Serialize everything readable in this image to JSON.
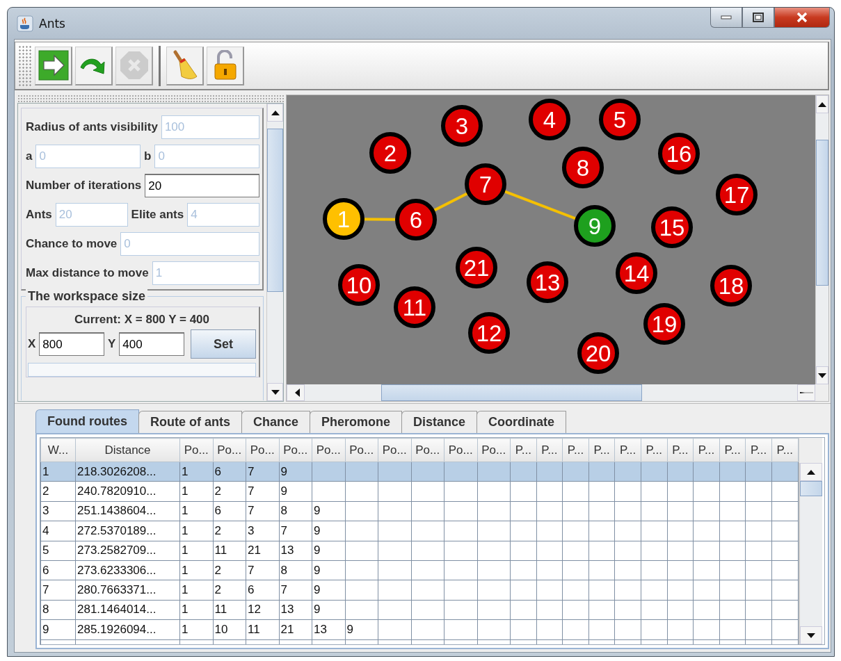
{
  "window": {
    "title": "Ants"
  },
  "toolbar": [
    {
      "kind": "run",
      "disabled": false
    },
    {
      "kind": "step",
      "disabled": false
    },
    {
      "kind": "stop",
      "disabled": true
    },
    {
      "kind": "clear",
      "disabled": false
    },
    {
      "kind": "unlock",
      "disabled": false
    }
  ],
  "parameters": [
    {
      "fields": [
        {
          "label": "Radius of ants visibility",
          "value": "100",
          "disabled": true
        }
      ]
    },
    {
      "fields": [
        {
          "label": "a",
          "value": "0",
          "disabled": true
        },
        {
          "label": "b",
          "value": "0",
          "disabled": true
        }
      ]
    },
    {
      "fields": [
        {
          "label": "Number of iterations",
          "value": "20",
          "disabled": false
        }
      ]
    },
    {
      "fields": [
        {
          "label": "Ants",
          "value": "20",
          "disabled": true
        },
        {
          "label": "Elite ants",
          "value": "4",
          "disabled": true
        }
      ]
    },
    {
      "fields": [
        {
          "label": "Chance to move",
          "value": "0",
          "disabled": true
        }
      ]
    },
    {
      "fields": [
        {
          "label": "Max distance to move",
          "value": "1",
          "disabled": true
        }
      ]
    }
  ],
  "workspace": {
    "title": "The workspace size",
    "current": "Current: X = 800 Y = 400",
    "fields": [
      {
        "label": "X",
        "value": "800",
        "disabled": false
      },
      {
        "label": "Y",
        "value": "400",
        "disabled": false
      }
    ],
    "button": "Set"
  },
  "nodes": [
    {
      "label": "1",
      "color": "#ffc000",
      "on_route": true
    },
    {
      "label": "2",
      "color": "#e00000",
      "on_route": false
    },
    {
      "label": "3",
      "color": "#e00000",
      "on_route": false
    },
    {
      "label": "4",
      "color": "#e00000",
      "on_route": false
    },
    {
      "label": "5",
      "color": "#e00000",
      "on_route": false
    },
    {
      "label": "6",
      "color": "#e00000",
      "on_route": true
    },
    {
      "label": "7",
      "color": "#e00000",
      "on_route": true
    },
    {
      "label": "8",
      "color": "#e00000",
      "on_route": false
    },
    {
      "label": "9",
      "color": "#1ea01e",
      "on_route": true
    },
    {
      "label": "10",
      "color": "#e00000",
      "on_route": false
    },
    {
      "label": "11",
      "color": "#e00000",
      "on_route": false
    },
    {
      "label": "12",
      "color": "#e00000",
      "on_route": false
    },
    {
      "label": "13",
      "color": "#e00000",
      "on_route": false
    },
    {
      "label": "14",
      "color": "#e00000",
      "on_route": false
    },
    {
      "label": "16",
      "color": "#e00000",
      "on_route": false
    },
    {
      "label": "15",
      "color": "#e00000",
      "on_route": false
    },
    {
      "label": "17",
      "color": "#e00000",
      "on_route": false
    },
    {
      "label": "18",
      "color": "#e00000",
      "on_route": false
    },
    {
      "label": "19",
      "color": "#e00000",
      "on_route": false
    },
    {
      "label": "20",
      "color": "#e00000",
      "on_route": false
    },
    {
      "label": "21",
      "color": "#e00000",
      "on_route": false
    }
  ],
  "tabs": [
    {
      "label": "Found routes",
      "selected": true
    },
    {
      "label": "Route of ants",
      "selected": false
    },
    {
      "label": "Chance",
      "selected": false
    },
    {
      "label": "Pheromone",
      "selected": false
    },
    {
      "label": "Distance",
      "selected": false
    },
    {
      "label": "Coordinate",
      "selected": false
    }
  ],
  "table": {
    "columns": [
      "W...",
      "Distance",
      "Po...",
      "Po...",
      "Po...",
      "Po...",
      "Po...",
      "Po...",
      "Po...",
      "Po...",
      "Po...",
      "Po...",
      "P...",
      "P...",
      "P...",
      "P...",
      "P...",
      "P...",
      "P...",
      "P...",
      "P...",
      "P...",
      "P..."
    ],
    "rows": [
      {
        "selected": true,
        "cells": [
          "1",
          "218.3026208...",
          "1",
          "6",
          "7",
          "9"
        ]
      },
      {
        "selected": false,
        "cells": [
          "2",
          "240.7820910...",
          "1",
          "2",
          "7",
          "9"
        ]
      },
      {
        "selected": false,
        "cells": [
          "3",
          "251.1438604...",
          "1",
          "6",
          "7",
          "8",
          "9"
        ]
      },
      {
        "selected": false,
        "cells": [
          "4",
          "272.5370189...",
          "1",
          "2",
          "3",
          "7",
          "9"
        ]
      },
      {
        "selected": false,
        "cells": [
          "5",
          "273.2582709...",
          "1",
          "11",
          "21",
          "13",
          "9"
        ]
      },
      {
        "selected": false,
        "cells": [
          "6",
          "273.6233306...",
          "1",
          "2",
          "7",
          "8",
          "9"
        ]
      },
      {
        "selected": false,
        "cells": [
          "7",
          "280.7663371...",
          "1",
          "2",
          "6",
          "7",
          "9"
        ]
      },
      {
        "selected": false,
        "cells": [
          "8",
          "281.1464014...",
          "1",
          "11",
          "12",
          "13",
          "9"
        ]
      },
      {
        "selected": false,
        "cells": [
          "9",
          "285.1926094...",
          "1",
          "10",
          "11",
          "21",
          "13",
          "9"
        ]
      }
    ]
  }
}
